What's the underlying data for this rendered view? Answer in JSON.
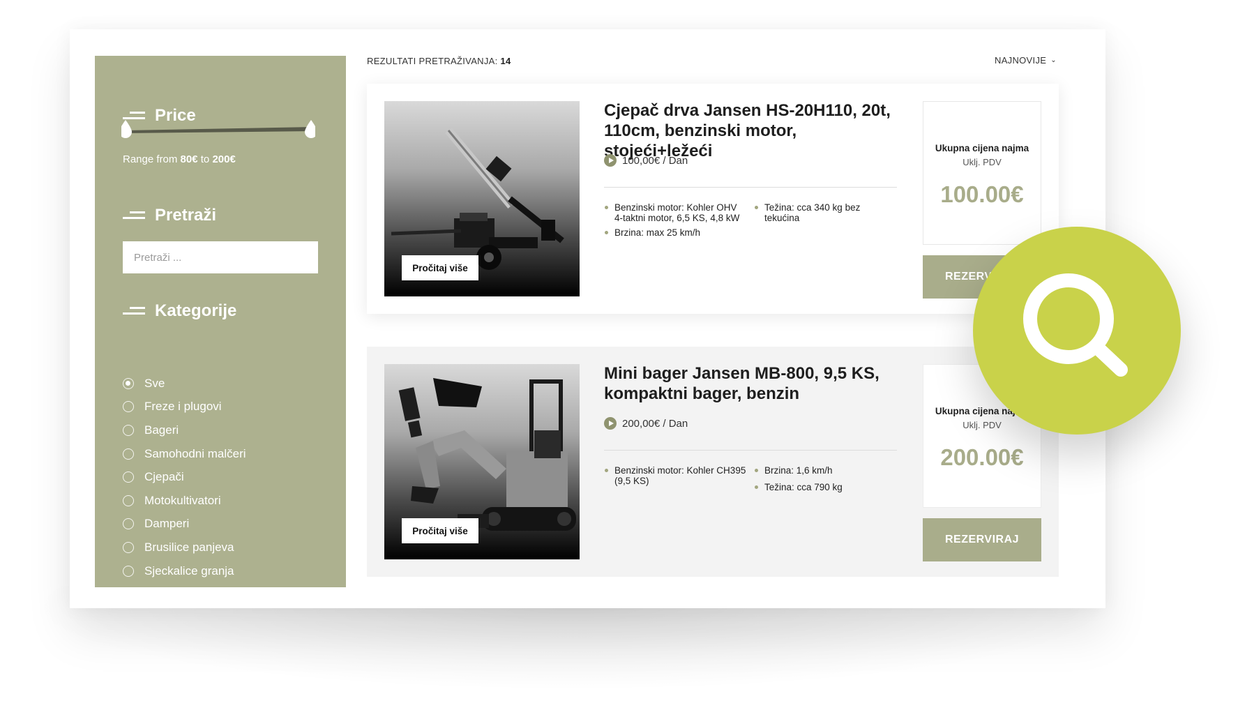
{
  "sidebar": {
    "price": {
      "title": "Price",
      "range_prefix": "Range from",
      "range_min": "80€",
      "range_joiner": "to",
      "range_max": "200€"
    },
    "search": {
      "title": "Pretraži",
      "placeholder": "Pretraži ..."
    },
    "categories": {
      "title": "Kategorije",
      "selected": "Sve",
      "items": [
        {
          "label": "Sve"
        },
        {
          "label": "Freze i plugovi"
        },
        {
          "label": "Bageri"
        },
        {
          "label": "Samohodni malčeri"
        },
        {
          "label": "Cjepači"
        },
        {
          "label": "Motokultivatori"
        },
        {
          "label": "Damperi"
        },
        {
          "label": "Brusilice panjeva"
        },
        {
          "label": "Sjeckalice granja"
        }
      ]
    }
  },
  "results": {
    "label": "REZULTATI PRETRAŽIVANJA:",
    "count": "14",
    "sort_label": "NAJNOVIJE"
  },
  "products": [
    {
      "title": "Cjepač drva Jansen HS-20H110, 20t, 110cm, benzinski motor, stojeći+ležeći",
      "price_per_day": "100,00€ / Dan",
      "read_more": "Pročitaj više",
      "specs": [
        "Benzinski motor: Kohler OHV 4-taktni motor, 6,5 KS, 4,8 kW",
        "Težina: cca 340 kg bez tekućina",
        "Brzina: max 25 km/h"
      ],
      "total_label": "Ukupna cijena najma",
      "vat_label": "Uklj. PDV",
      "total_price": "100.00€",
      "reserve_label": "REZERVIRAJ"
    },
    {
      "title": "Mini bager Jansen MB-800, 9,5 KS, kompaktni bager, benzin",
      "price_per_day": "200,00€ / Dan",
      "read_more": "Pročitaj više",
      "specs": [
        "Benzinski motor: Kohler CH395 (9,5 KS)",
        "Brzina: 1,6 km/h",
        "Težina: cca 790 kg"
      ],
      "total_label": "Ukupna cijena najma",
      "vat_label": "Uklj. PDV",
      "total_price": "200.00€",
      "reserve_label": "REZERVIRAJ"
    }
  ],
  "icons": {
    "overlay": "search-icon",
    "sort": "chevron-down-icon",
    "price_marker": "play-icon"
  },
  "colors": {
    "sidebar_bg": "#adb18f",
    "accent_green": "#c9d24a",
    "button_bg": "#a9ad8b",
    "price_text": "#a8ac8a"
  }
}
